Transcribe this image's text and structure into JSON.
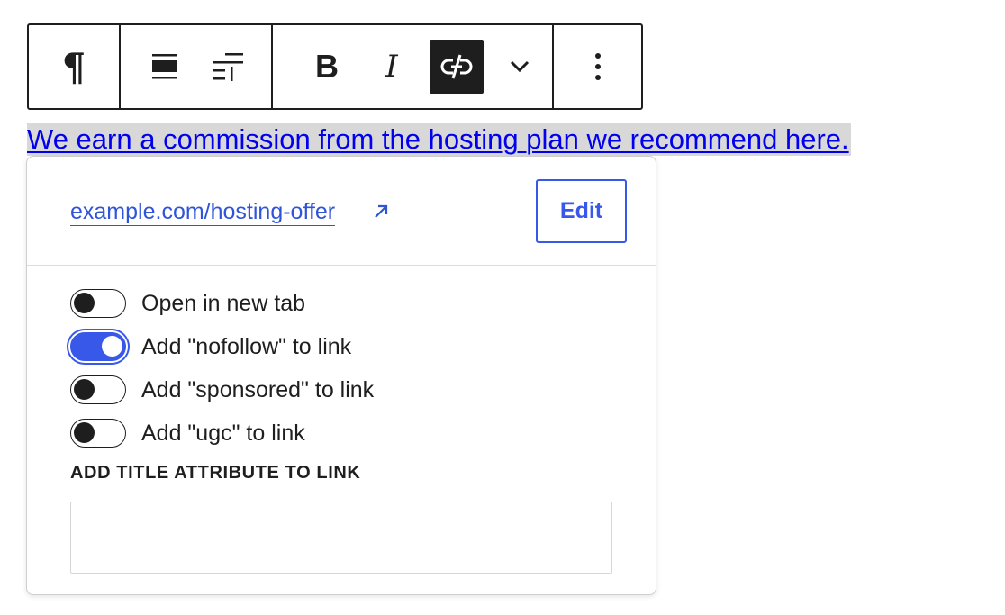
{
  "toolbar": {
    "paragraph_icon": "pilcrow-icon",
    "align_icon": "align-justify-icon",
    "align_left_icon": "align-left-icon",
    "bold_label": "B",
    "italic_label": "I",
    "unlink_icon": "unlink-icon",
    "more_rich_text_icon": "chevron-down-icon",
    "options_icon": "more-vertical-icon"
  },
  "content": {
    "link_text": "We earn a commission from the hosting plan we recommend here."
  },
  "link_popover": {
    "url": "example.com/hosting-offer",
    "external_icon": "arrow-up-right-icon",
    "edit_label": "Edit",
    "toggles": [
      {
        "label": "Open in new tab",
        "checked": false
      },
      {
        "label": "Add \"nofollow\" to link",
        "checked": true
      },
      {
        "label": "Add \"sponsored\" to link",
        "checked": false
      },
      {
        "label": "Add \"ugc\" to link",
        "checked": false
      }
    ],
    "title_attribute_label": "ADD TITLE ATTRIBUTE TO LINK",
    "title_attribute_value": ""
  },
  "colors": {
    "accent": "#3858e9",
    "link": "#0000ee",
    "text": "#1e1e1e",
    "selection": "#d8d8d8"
  }
}
